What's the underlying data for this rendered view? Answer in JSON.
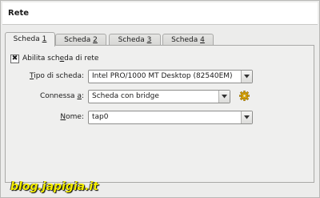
{
  "header": {
    "title": "Rete"
  },
  "tabs": [
    {
      "label": "Scheda ",
      "num": "1",
      "active": true
    },
    {
      "label": "Scheda ",
      "num": "2",
      "active": false
    },
    {
      "label": "Scheda ",
      "num": "3",
      "active": false
    },
    {
      "label": "Scheda ",
      "num": "4",
      "active": false
    }
  ],
  "enable": {
    "checked": true,
    "check_mark": "✖",
    "label_pre": "Abilita sch",
    "label_acc": "e",
    "label_post": "da di rete"
  },
  "type": {
    "label_acc": "T",
    "label_post": "ipo di scheda:",
    "value": "Intel PRO/1000 MT Desktop (82540EM)"
  },
  "attached": {
    "label_pre": "Connessa ",
    "label_acc": "a",
    "label_post": ":",
    "value": "Scheda con bridge"
  },
  "name": {
    "label_acc": "N",
    "label_post": "ome:",
    "value": "tap0"
  },
  "icons": {
    "dropdown": "chevron-down-icon",
    "settings": "gear-icon"
  },
  "colors": {
    "watermark": "#f6f000",
    "gear": "#e0a800"
  },
  "watermark": "blog.japigia.it"
}
